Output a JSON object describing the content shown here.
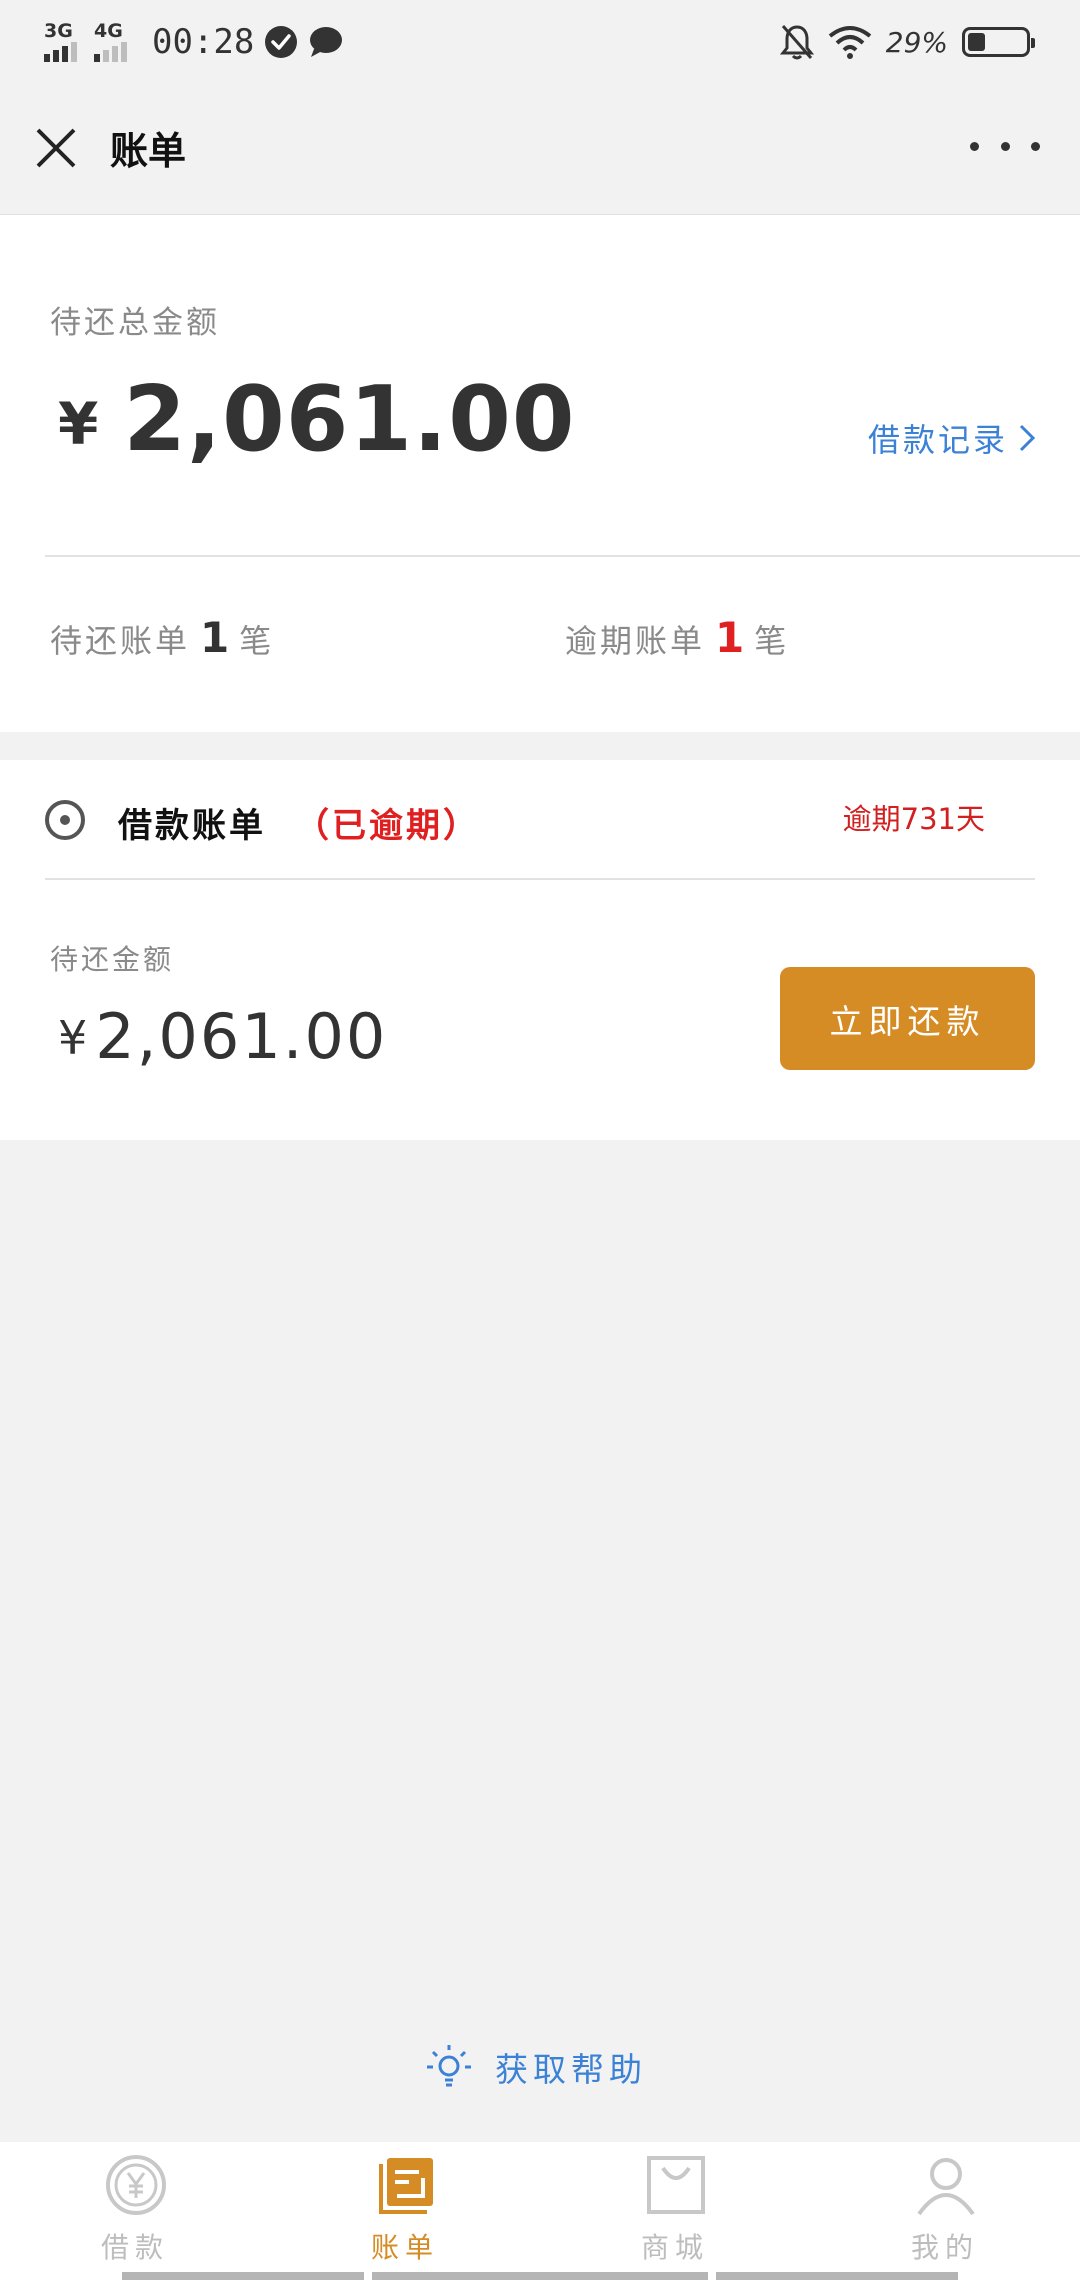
{
  "status_bar": {
    "signal1_label": "3G",
    "signal2_label": "4G",
    "time": "00:28",
    "battery_text": "29%"
  },
  "header": {
    "title": "账单"
  },
  "summary": {
    "total_label": "待还总金额",
    "currency": "¥",
    "total_amount": "2,061.00",
    "record_link": "借款记录",
    "pending_prefix": "待还账单",
    "pending_count": "1",
    "pending_suffix": "笔",
    "overdue_prefix": "逾期账单",
    "overdue_count": "1",
    "overdue_suffix": "笔"
  },
  "bill": {
    "title": "借款账单",
    "status": "（已逾期）",
    "overdue_days": "逾期731天",
    "amount_label": "待还金额",
    "currency": "¥",
    "amount": "2,061.00",
    "pay_button": "立即还款"
  },
  "help": {
    "label": "获取帮助"
  },
  "tabs": [
    {
      "label": "借款",
      "icon": "yen-circle-icon",
      "active": false
    },
    {
      "label": "账单",
      "icon": "bill-icon",
      "active": true
    },
    {
      "label": "商城",
      "icon": "shopping-bag-icon",
      "active": false
    },
    {
      "label": "我的",
      "icon": "person-icon",
      "active": false
    }
  ],
  "colors": {
    "accent": "#d68c24",
    "link": "#3b82d6",
    "danger": "#e02020",
    "inactive": "#bdbdbd"
  }
}
